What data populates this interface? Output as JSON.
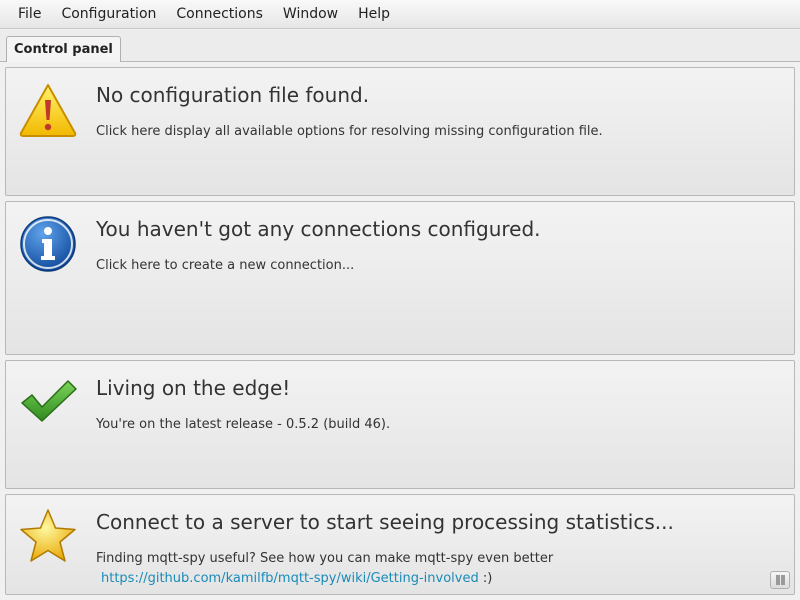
{
  "menu": {
    "items": [
      "File",
      "Configuration",
      "Connections",
      "Window",
      "Help"
    ]
  },
  "tabs": [
    {
      "label": "Control panel",
      "active": true
    }
  ],
  "panels": [
    {
      "icon": "warning-icon",
      "title": "No configuration file found.",
      "description": "Click here display all available options for resolving missing configuration file."
    },
    {
      "icon": "info-icon",
      "title": "You haven't got any connections configured.",
      "description": "Click here to create a new connection..."
    },
    {
      "icon": "checkmark-icon",
      "title": "Living on the edge!",
      "description": "You're on the latest release - 0.5.2 (build 46)."
    },
    {
      "icon": "star-icon",
      "title": "Connect to a server to start seeing processing statistics...",
      "description": "Finding mqtt-spy useful? See how you can make mqtt-spy even better",
      "link": "https://github.com/kamilfb/mqtt-spy/wiki/Getting-involved",
      "link_suffix": " :)"
    }
  ],
  "colors": {
    "link": "#1a8bb8",
    "warning_yellow": "#f5c400",
    "info_blue": "#1a5fb4",
    "check_green": "#3a9a2a",
    "star_gold": "#f2c200"
  }
}
